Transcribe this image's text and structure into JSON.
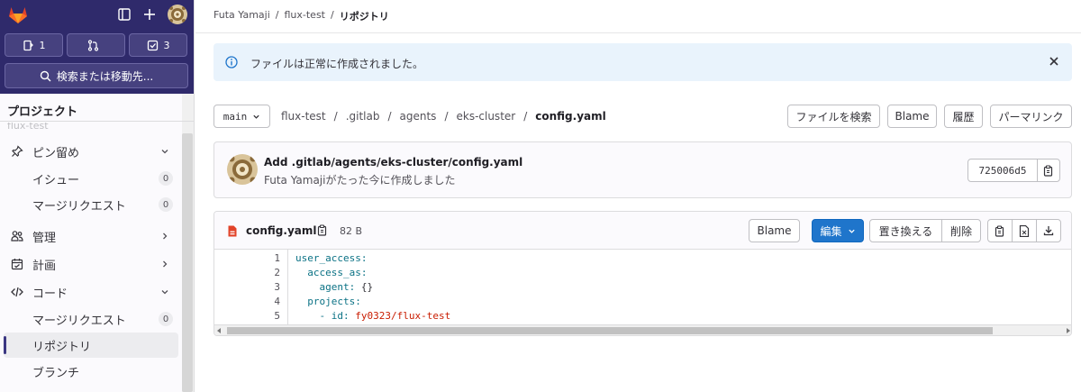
{
  "sidebar": {
    "counters": [
      {
        "icon": "issues-icon",
        "count": "1"
      },
      {
        "icon": "merge-request-icon",
        "count": ""
      },
      {
        "icon": "todo-icon",
        "count": "3"
      }
    ],
    "search_label": "検索または移動先...",
    "section_title": "プロジェクト",
    "faded_project": "flux-test",
    "items": [
      {
        "label": "ピン留め",
        "icon": "pin-icon",
        "chevron": "down"
      },
      {
        "label": "イシュー",
        "badge": "0"
      },
      {
        "label": "マージリクエスト",
        "badge": "0"
      },
      {
        "label": "管理",
        "icon": "manage-icon",
        "chevron": "right"
      },
      {
        "label": "計画",
        "icon": "plan-icon",
        "chevron": "right"
      },
      {
        "label": "コード",
        "icon": "code-icon",
        "chevron": "down"
      },
      {
        "label": "マージリクエスト",
        "badge": "0"
      },
      {
        "label": "リポジトリ",
        "active": true
      },
      {
        "label": "ブランチ"
      }
    ]
  },
  "breadcrumb": {
    "items": [
      "Futa Yamaji",
      "flux-test",
      "リポジトリ"
    ],
    "separator": "/"
  },
  "alert": {
    "message": "ファイルは正常に作成されました。"
  },
  "repo": {
    "branch": "main",
    "path": [
      "flux-test",
      ".gitlab",
      "agents",
      "eks-cluster"
    ],
    "file": "config.yaml",
    "separator": "/",
    "actions": [
      "ファイルを検索",
      "Blame",
      "履歴",
      "パーマリンク"
    ]
  },
  "commit": {
    "message": "Add .gitlab/agents/eks-cluster/config.yaml",
    "author": "Futa Yamaji",
    "time_text": "がたった今に作成しました",
    "sha": "725006d5"
  },
  "file": {
    "name": "config.yaml",
    "size": "82 B",
    "blame": "Blame",
    "edit": "編集",
    "replace": "置き換える",
    "delete": "削除",
    "lines": [
      {
        "n": "1",
        "indent": "",
        "key": "user_access:",
        "val": ""
      },
      {
        "n": "2",
        "indent": "  ",
        "key": "access_as:",
        "val": ""
      },
      {
        "n": "3",
        "indent": "    ",
        "key": "agent:",
        "val": " {}"
      },
      {
        "n": "4",
        "indent": "  ",
        "key": "projects:",
        "val": ""
      },
      {
        "n": "5",
        "indent": "    ",
        "key": "- id:",
        "val": " fy0323/flux-test"
      }
    ]
  },
  "colors": {
    "sidebar_top": "#2f2a6b",
    "primary": "#1f75cb",
    "alert_bg": "#e9f3fc"
  }
}
